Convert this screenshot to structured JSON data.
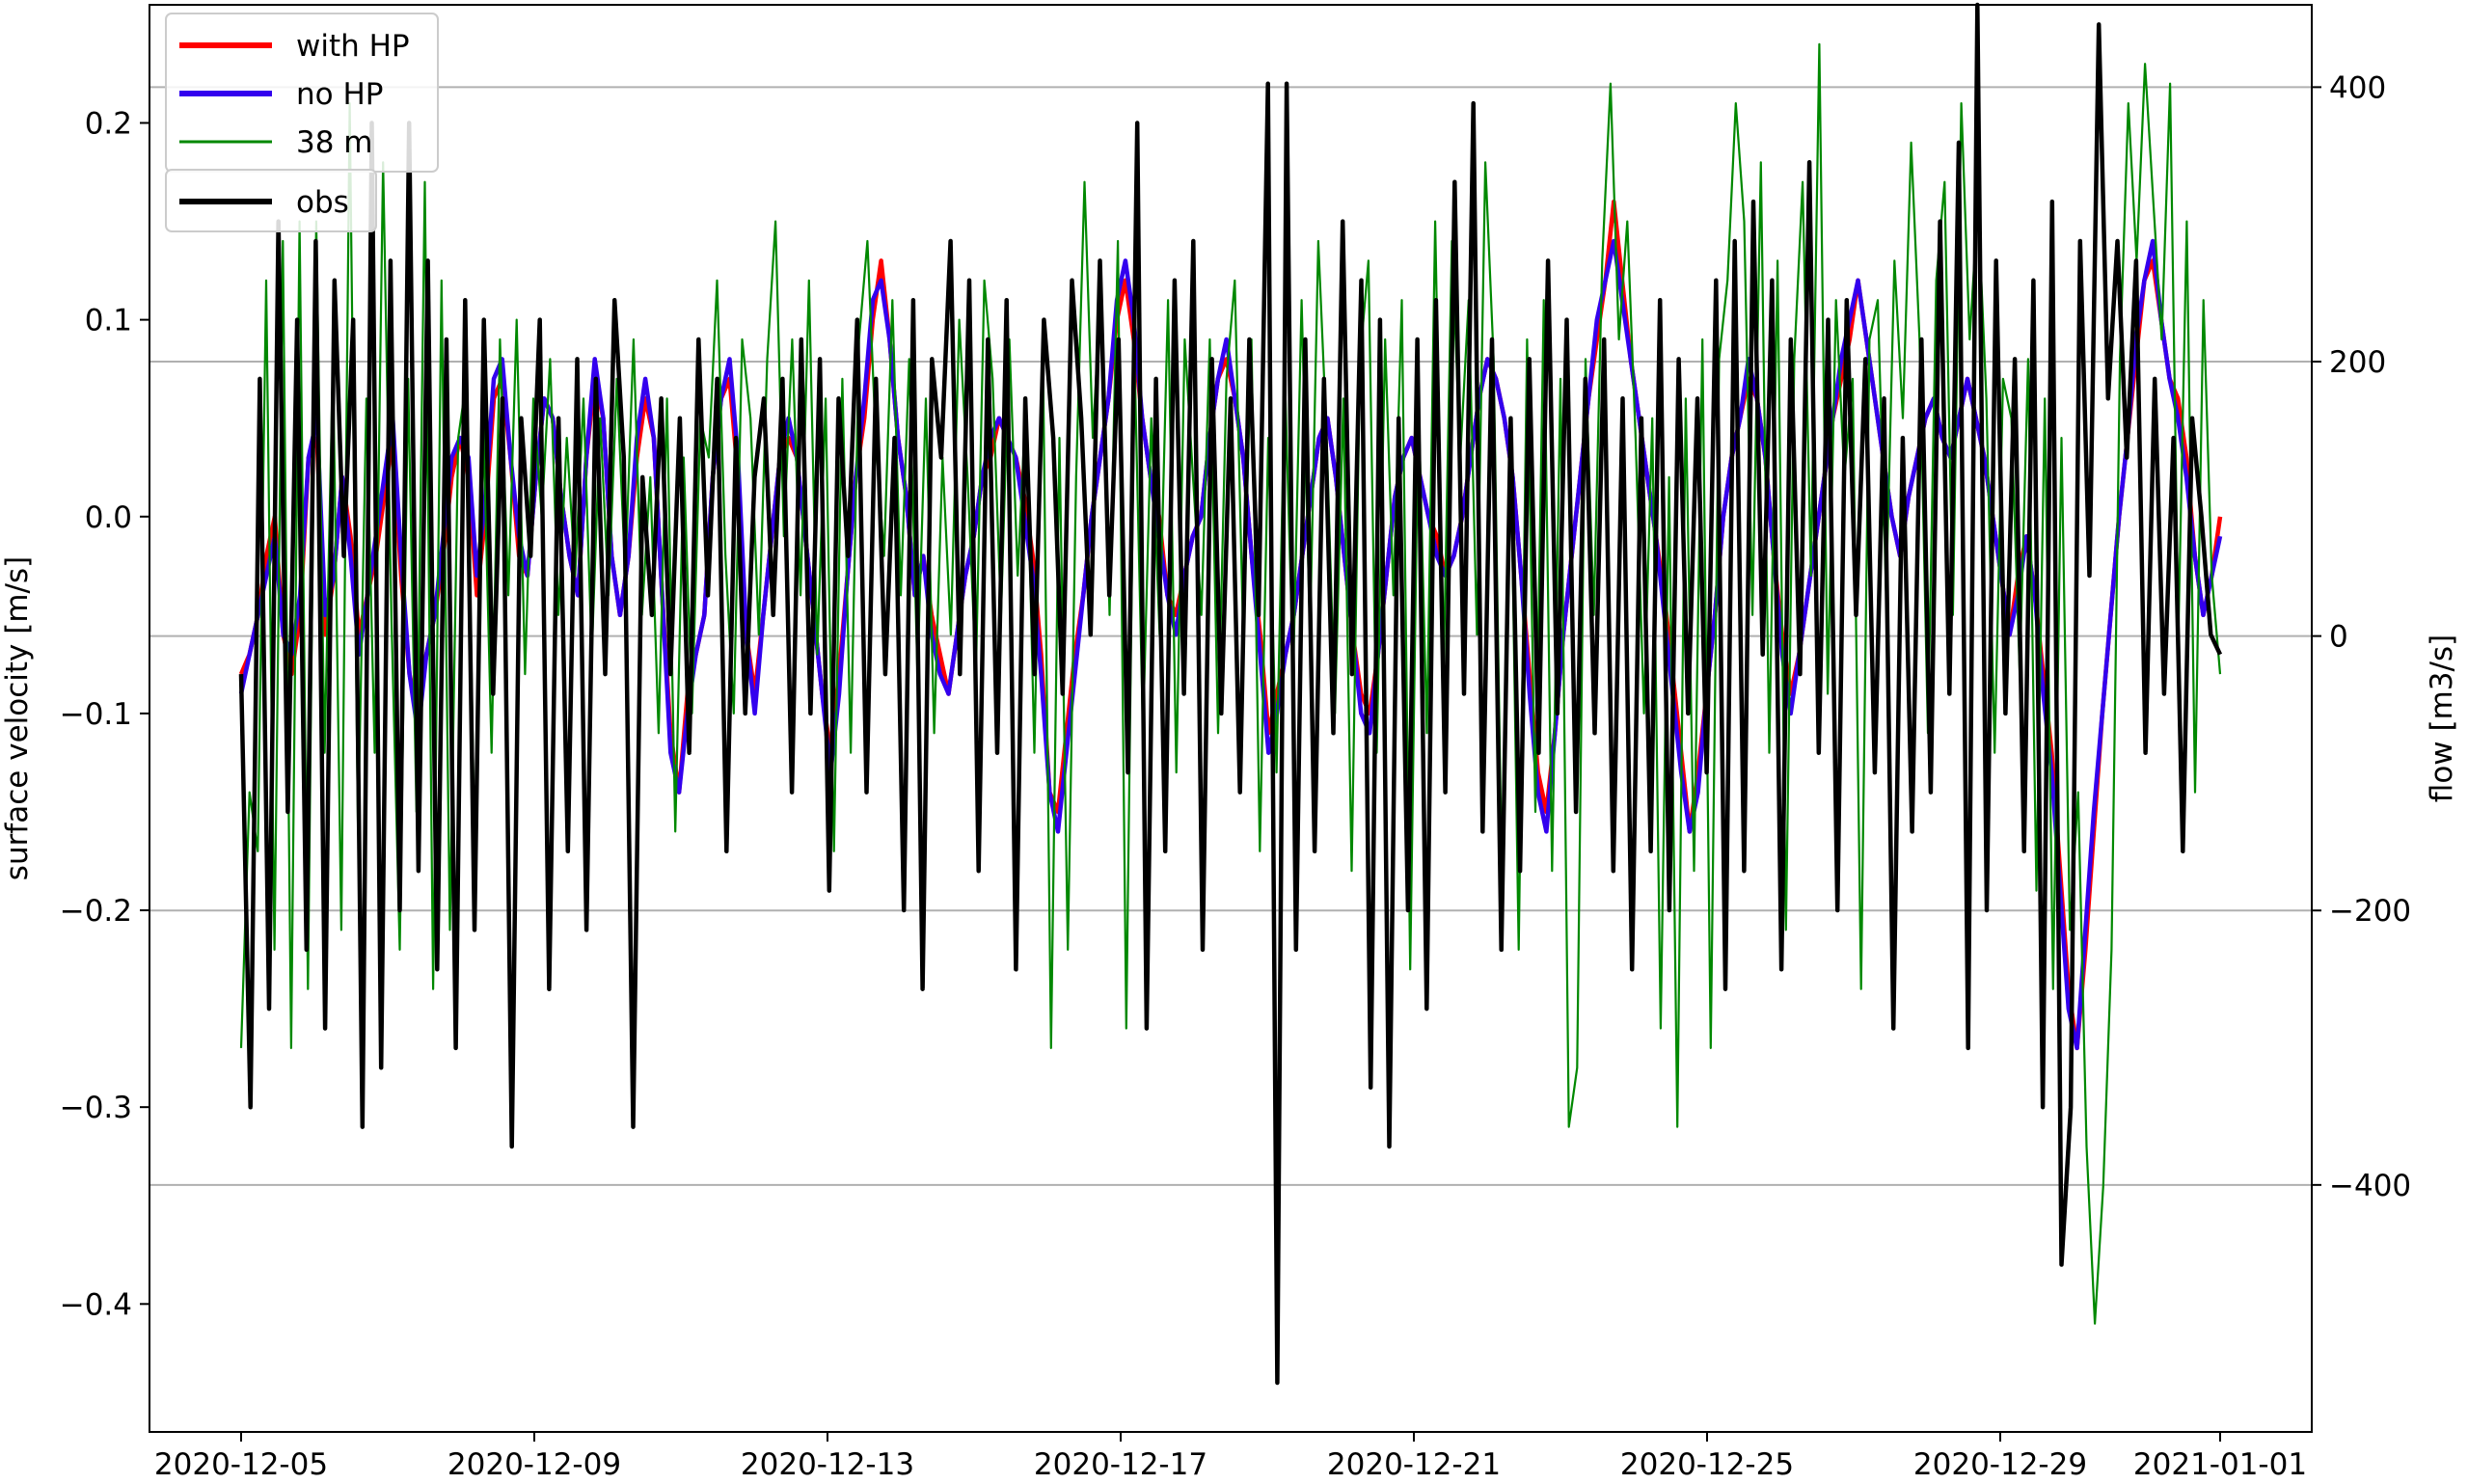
{
  "chart_data": {
    "type": "line",
    "title": "",
    "ylabel": "surface velocity [m/s]",
    "ylabel_right": "flow [m3/s]",
    "xlabel": "",
    "x_start": "2020-12-05",
    "x_end": "2021-01-01",
    "xlim": [
      "2020-12-03 18:00",
      "2021-01-02 06:00"
    ],
    "x_ticks": [
      "2020-12-05",
      "2020-12-09",
      "2020-12-13",
      "2020-12-17",
      "2020-12-21",
      "2020-12-25",
      "2020-12-29",
      "2021-01-01"
    ],
    "ylim": [
      -0.465,
      0.26
    ],
    "y_ticks": [
      -0.4,
      -0.3,
      -0.2,
      -0.1,
      0.0,
      0.1,
      0.2
    ],
    "y_tick_labels": [
      "−0.4",
      "−0.3",
      "−0.2",
      "−0.1",
      "0.0",
      "0.1",
      "0.2"
    ],
    "ylim_right": [
      -580,
      460
    ],
    "y_ticks_right": [
      -400,
      -200,
      0,
      200,
      400
    ],
    "y_tick_labels_right": [
      "−400",
      "−200",
      "0",
      "200",
      "400"
    ],
    "grid": "horizontal lines at right-axis ticks",
    "legend_placement": "top-left",
    "series": [
      {
        "name": "with HP",
        "color": "#ff0000",
        "axis": "left",
        "values": [
          -0.08,
          -0.07,
          -0.05,
          -0.02,
          0.0,
          -0.06,
          -0.08,
          -0.05,
          0.03,
          0.04,
          -0.06,
          -0.03,
          0.02,
          -0.01,
          -0.06,
          -0.04,
          -0.02,
          0.01,
          0.04,
          -0.03,
          -0.08,
          -0.1,
          -0.07,
          -0.05,
          -0.02,
          0.02,
          0.04,
          0.02,
          -0.04,
          0.0,
          0.06,
          0.07,
          0.03,
          -0.02,
          -0.03,
          0.02,
          0.06,
          0.05,
          0.01,
          -0.02,
          -0.04,
          0.03,
          0.07,
          0.05,
          -0.02,
          -0.05,
          -0.02,
          0.03,
          0.06,
          0.04,
          -0.04,
          -0.11,
          -0.14,
          -0.09,
          -0.07,
          -0.05,
          0.02,
          0.06,
          0.07,
          0.02,
          -0.06,
          -0.09,
          -0.05,
          -0.01,
          0.03,
          0.04,
          0.03,
          -0.01,
          -0.05,
          -0.09,
          -0.12,
          -0.08,
          -0.03,
          0.02,
          0.05,
          0.1,
          0.13,
          0.09,
          0.04,
          0.01,
          -0.04,
          -0.02,
          -0.05,
          -0.07,
          -0.09,
          -0.06,
          -0.03,
          -0.01,
          0.02,
          0.03,
          0.05,
          0.04,
          0.03,
          0.01,
          -0.02,
          -0.07,
          -0.14,
          -0.15,
          -0.11,
          -0.07,
          -0.04,
          0.0,
          0.03,
          0.06,
          0.1,
          0.12,
          0.09,
          0.05,
          0.02,
          0.0,
          -0.04,
          -0.05,
          -0.03,
          -0.01,
          0.0,
          0.04,
          0.07,
          0.08,
          0.06,
          0.03,
          -0.02,
          -0.06,
          -0.11,
          -0.09,
          -0.07,
          -0.05,
          -0.02,
          0.01,
          0.04,
          0.05,
          0.02,
          -0.02,
          -0.06,
          -0.09,
          -0.1,
          -0.07,
          -0.03,
          0.01,
          0.03,
          0.04,
          0.02,
          0.0,
          -0.01,
          -0.03,
          -0.02,
          0.0,
          0.03,
          0.06,
          0.08,
          0.07,
          0.05,
          0.02,
          -0.03,
          -0.08,
          -0.13,
          -0.15,
          -0.11,
          -0.06,
          -0.02,
          0.02,
          0.06,
          0.09,
          0.12,
          0.16,
          0.12,
          0.08,
          0.05,
          0.02,
          -0.01,
          -0.04,
          -0.08,
          -0.12,
          -0.16,
          -0.13,
          -0.09,
          -0.05,
          0.0,
          0.03,
          0.05,
          0.07,
          0.06,
          0.03,
          -0.02,
          -0.06,
          -0.09,
          -0.07,
          -0.04,
          -0.01,
          0.02,
          0.05,
          0.07,
          0.09,
          0.12,
          0.09,
          0.06,
          0.03,
          0.0,
          -0.02,
          0.01,
          0.03,
          0.05,
          0.06,
          0.04,
          0.03,
          0.05,
          0.07,
          0.05,
          0.03,
          0.0,
          -0.03,
          -0.06,
          -0.03,
          -0.01,
          -0.04,
          -0.08,
          -0.12,
          -0.18,
          -0.24,
          -0.27,
          -0.22,
          -0.16,
          -0.1,
          -0.05,
          0.0,
          0.04,
          0.08,
          0.12,
          0.13,
          0.1,
          0.07,
          0.06,
          0.03,
          -0.02,
          -0.05,
          -0.03,
          0.0
        ]
      },
      {
        "name": "no HP",
        "color": "#3300ee",
        "axis": "left",
        "values": [
          -0.09,
          -0.07,
          -0.05,
          -0.03,
          -0.01,
          -0.06,
          -0.07,
          -0.04,
          0.03,
          0.05,
          -0.05,
          -0.03,
          0.02,
          -0.02,
          -0.07,
          -0.04,
          -0.01,
          0.02,
          0.05,
          -0.02,
          -0.08,
          -0.11,
          -0.07,
          -0.05,
          -0.01,
          0.03,
          0.04,
          0.03,
          -0.03,
          0.01,
          0.07,
          0.08,
          0.03,
          -0.01,
          -0.03,
          0.02,
          0.06,
          0.05,
          0.01,
          -0.02,
          -0.04,
          0.03,
          0.08,
          0.05,
          -0.02,
          -0.05,
          -0.02,
          0.04,
          0.07,
          0.04,
          -0.04,
          -0.12,
          -0.14,
          -0.1,
          -0.07,
          -0.05,
          0.02,
          0.06,
          0.08,
          0.03,
          -0.06,
          -0.1,
          -0.05,
          -0.01,
          0.03,
          0.05,
          0.03,
          -0.01,
          -0.05,
          -0.09,
          -0.13,
          -0.09,
          -0.03,
          0.02,
          0.06,
          0.11,
          0.12,
          0.09,
          0.04,
          0.01,
          -0.04,
          -0.02,
          -0.06,
          -0.08,
          -0.09,
          -0.06,
          -0.03,
          -0.01,
          0.02,
          0.04,
          0.05,
          0.04,
          0.03,
          0.0,
          -0.03,
          -0.08,
          -0.14,
          -0.16,
          -0.12,
          -0.08,
          -0.04,
          0.0,
          0.03,
          0.06,
          0.11,
          0.13,
          0.1,
          0.05,
          0.02,
          -0.01,
          -0.04,
          -0.06,
          -0.03,
          -0.01,
          0.0,
          0.04,
          0.07,
          0.09,
          0.06,
          0.03,
          -0.02,
          -0.07,
          -0.12,
          -0.1,
          -0.07,
          -0.05,
          -0.02,
          0.01,
          0.04,
          0.05,
          0.02,
          -0.02,
          -0.06,
          -0.1,
          -0.11,
          -0.07,
          -0.03,
          0.01,
          0.03,
          0.04,
          0.02,
          0.0,
          -0.02,
          -0.03,
          -0.02,
          0.0,
          0.03,
          0.06,
          0.08,
          0.07,
          0.05,
          0.02,
          -0.03,
          -0.09,
          -0.14,
          -0.16,
          -0.11,
          -0.06,
          -0.02,
          0.02,
          0.06,
          0.1,
          0.12,
          0.14,
          0.11,
          0.08,
          0.05,
          0.02,
          -0.01,
          -0.05,
          -0.09,
          -0.13,
          -0.16,
          -0.14,
          -0.09,
          -0.05,
          0.0,
          0.03,
          0.05,
          0.08,
          0.06,
          0.03,
          -0.02,
          -0.07,
          -0.1,
          -0.07,
          -0.04,
          -0.01,
          0.02,
          0.05,
          0.08,
          0.1,
          0.12,
          0.09,
          0.06,
          0.03,
          0.0,
          -0.02,
          0.01,
          0.03,
          0.05,
          0.06,
          0.04,
          0.03,
          0.05,
          0.07,
          0.05,
          0.03,
          0.0,
          -0.03,
          -0.06,
          -0.04,
          -0.01,
          -0.04,
          -0.09,
          -0.13,
          -0.19,
          -0.25,
          -0.27,
          -0.21,
          -0.15,
          -0.1,
          -0.05,
          0.0,
          0.04,
          0.09,
          0.12,
          0.14,
          0.1,
          0.07,
          0.05,
          0.02,
          -0.02,
          -0.05,
          -0.03,
          -0.01
        ]
      },
      {
        "name": "38 m",
        "color": "#008800",
        "axis": "left",
        "values": [
          -0.27,
          -0.14,
          -0.17,
          0.12,
          -0.22,
          0.14,
          -0.27,
          0.15,
          -0.24,
          0.15,
          -0.12,
          0.08,
          -0.21,
          0.21,
          -0.16,
          0.06,
          -0.12,
          0.18,
          -0.05,
          -0.22,
          0.07,
          -0.15,
          0.17,
          -0.24,
          0.12,
          -0.21,
          0.04,
          0.07,
          -0.18,
          0.05,
          -0.12,
          0.09,
          -0.04,
          0.1,
          -0.08,
          0.06,
          0.0,
          0.08,
          -0.05,
          0.04,
          -0.03,
          0.06,
          -0.07,
          0.05,
          -0.04,
          0.07,
          -0.03,
          0.09,
          -0.05,
          0.02,
          -0.11,
          0.06,
          -0.16,
          0.03,
          -0.1,
          0.05,
          0.03,
          0.12,
          -0.02,
          -0.1,
          0.09,
          0.05,
          -0.06,
          0.08,
          0.15,
          -0.01,
          0.09,
          -0.04,
          0.12,
          -0.07,
          0.06,
          -0.17,
          0.07,
          -0.12,
          0.09,
          0.14,
          0.04,
          -0.02,
          0.11,
          -0.04,
          0.08,
          -0.08,
          0.06,
          -0.11,
          0.03,
          -0.06,
          0.1,
          0.02,
          -0.08,
          0.12,
          0.07,
          -0.05,
          0.09,
          -0.03,
          0.06,
          -0.12,
          0.09,
          -0.27,
          0.04,
          -0.22,
          0.02,
          0.17,
          0.04,
          0.12,
          -0.05,
          0.14,
          -0.26,
          0.08,
          -0.11,
          0.05,
          -0.06,
          0.11,
          -0.13,
          0.09,
          0.02,
          -0.05,
          0.09,
          -0.11,
          0.07,
          0.12,
          -0.06,
          0.09,
          -0.17,
          0.04,
          -0.13,
          0.07,
          -0.08,
          0.11,
          -0.06,
          0.14,
          0.04,
          -0.1,
          0.06,
          -0.18,
          0.08,
          0.13,
          -0.12,
          0.09,
          -0.04,
          0.11,
          -0.23,
          0.06,
          -0.11,
          0.15,
          -0.08,
          0.14,
          0.03,
          0.11,
          -0.06,
          0.18,
          0.08,
          -0.19,
          0.05,
          -0.22,
          0.09,
          -0.15,
          0.11,
          -0.18,
          0.07,
          -0.31,
          -0.28,
          0.08,
          -0.05,
          0.13,
          0.22,
          0.09,
          0.15,
          0.04,
          -0.1,
          0.05,
          -0.26,
          0.02,
          -0.31,
          0.06,
          -0.18,
          0.09,
          -0.27,
          0.08,
          0.12,
          0.21,
          0.15,
          -0.05,
          0.18,
          -0.12,
          0.13,
          -0.21,
          0.08,
          0.17,
          -0.03,
          0.24,
          -0.09,
          0.11,
          0.02,
          0.07,
          -0.24,
          0.09,
          0.11,
          -0.04,
          0.13,
          0.05,
          0.19,
          0.09,
          -0.11,
          0.12,
          0.17,
          -0.05,
          0.21,
          0.09,
          0.16,
          0.06,
          -0.12,
          0.07,
          0.05,
          -0.08,
          0.08,
          -0.19,
          0.06,
          -0.24,
          0.04,
          -0.21,
          -0.14,
          -0.32,
          -0.41,
          -0.34,
          -0.22,
          0.08,
          0.21,
          0.13,
          0.23,
          0.16,
          0.09,
          0.22,
          -0.06,
          0.15,
          -0.14,
          0.11,
          -0.03,
          -0.08
        ]
      },
      {
        "name": "obs",
        "color": "#000000",
        "axis": "left",
        "values": [
          -0.08,
          -0.3,
          0.07,
          -0.25,
          0.15,
          -0.15,
          0.1,
          -0.22,
          0.14,
          -0.26,
          0.12,
          -0.02,
          0.1,
          -0.31,
          0.2,
          -0.28,
          0.13,
          -0.2,
          0.2,
          -0.18,
          0.13,
          -0.23,
          0.09,
          -0.27,
          0.11,
          -0.21,
          0.1,
          -0.09,
          0.06,
          -0.32,
          0.05,
          -0.02,
          0.1,
          -0.24,
          0.05,
          -0.17,
          0.08,
          -0.21,
          0.07,
          -0.08,
          0.11,
          0.03,
          -0.31,
          0.02,
          -0.05,
          0.06,
          -0.08,
          0.05,
          -0.12,
          0.09,
          -0.04,
          0.07,
          -0.17,
          0.04,
          -0.1,
          0.02,
          0.06,
          -0.05,
          0.07,
          -0.14,
          0.09,
          -0.1,
          0.08,
          -0.19,
          0.06,
          -0.02,
          0.1,
          -0.14,
          0.07,
          -0.08,
          0.04,
          -0.2,
          0.11,
          -0.24,
          0.08,
          0.03,
          0.14,
          -0.08,
          0.12,
          -0.18,
          0.09,
          -0.12,
          0.11,
          -0.23,
          0.06,
          -0.08,
          0.1,
          0.04,
          -0.09,
          0.12,
          0.05,
          -0.06,
          0.13,
          -0.04,
          0.09,
          -0.13,
          0.2,
          -0.26,
          0.07,
          -0.17,
          0.12,
          -0.09,
          0.14,
          -0.22,
          0.08,
          -0.1,
          0.06,
          -0.14,
          0.09,
          -0.05,
          0.22,
          -0.44,
          0.22,
          -0.22,
          0.09,
          -0.17,
          0.07,
          -0.11,
          0.15,
          -0.08,
          0.12,
          -0.29,
          0.1,
          -0.32,
          0.05,
          -0.2,
          0.09,
          -0.25,
          0.11,
          -0.14,
          0.17,
          -0.09,
          0.21,
          -0.16,
          0.09,
          -0.22,
          0.05,
          -0.18,
          0.08,
          -0.12,
          0.13,
          -0.1,
          0.1,
          -0.15,
          0.07,
          -0.11,
          0.09,
          -0.18,
          0.06,
          -0.23,
          0.05,
          -0.17,
          0.11,
          -0.2,
          0.08,
          -0.1,
          0.06,
          -0.13,
          0.12,
          -0.24,
          0.14,
          -0.18,
          0.16,
          -0.07,
          0.12,
          -0.23,
          0.09,
          -0.08,
          0.18,
          -0.12,
          0.1,
          -0.2,
          0.11,
          -0.05,
          0.08,
          -0.13,
          0.06,
          -0.26,
          0.04,
          -0.16,
          0.09,
          -0.14,
          0.15,
          -0.09,
          0.19,
          -0.27,
          0.26,
          -0.2,
          0.13,
          -0.1,
          0.08,
          -0.17,
          0.12,
          -0.3,
          0.16,
          -0.38,
          -0.3,
          0.14,
          -0.03,
          0.25,
          0.06,
          0.14,
          0.03,
          0.13,
          -0.12,
          0.07,
          -0.09,
          0.04,
          -0.17,
          0.05,
          0.0,
          -0.06,
          -0.07
        ]
      }
    ],
    "legend": [
      {
        "label": "with HP",
        "color": "#ff0000"
      },
      {
        "label": "no HP",
        "color": "#3300ee"
      },
      {
        "label": "38 m",
        "color": "#008800"
      }
    ],
    "legend2": [
      {
        "label": "obs",
        "color": "#000000"
      }
    ]
  }
}
